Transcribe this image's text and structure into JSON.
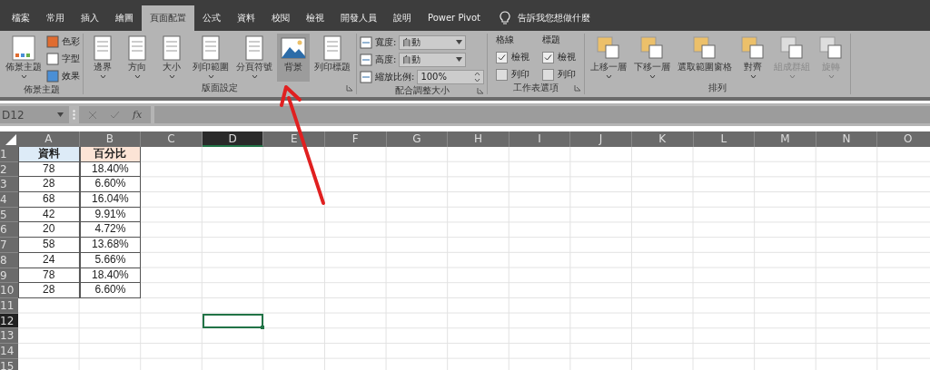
{
  "tabs": [
    {
      "label": "檔案",
      "selected": false
    },
    {
      "label": "常用",
      "selected": false
    },
    {
      "label": "插入",
      "selected": false
    },
    {
      "label": "繪圖",
      "selected": false
    },
    {
      "label": "頁面配置",
      "selected": true
    },
    {
      "label": "公式",
      "selected": false
    },
    {
      "label": "資料",
      "selected": false
    },
    {
      "label": "校閱",
      "selected": false
    },
    {
      "label": "檢視",
      "selected": false
    },
    {
      "label": "開發人員",
      "selected": false
    },
    {
      "label": "說明",
      "selected": false
    },
    {
      "label": "Power Pivot",
      "selected": false
    }
  ],
  "tell_me": "告訴我您想做什麼",
  "groups": [
    {
      "kind": "theme",
      "label": "佈景主題",
      "launcher": false,
      "large": [
        {
          "label": "佈景主題",
          "dropdown": true,
          "disabled": false,
          "highlighted": false
        }
      ],
      "small": [
        "色彩",
        "字型",
        "效果"
      ]
    },
    {
      "kind": "buttons",
      "label": "版面設定",
      "launcher": true,
      "large": [
        {
          "label": "邊界",
          "dropdown": true,
          "disabled": false,
          "highlighted": false
        },
        {
          "label": "方向",
          "dropdown": true,
          "disabled": false,
          "highlighted": false
        },
        {
          "label": "大小",
          "dropdown": true,
          "disabled": false,
          "highlighted": false
        },
        {
          "label": "列印範圍",
          "dropdown": true,
          "disabled": false,
          "highlighted": false
        },
        {
          "label": "分頁符號",
          "dropdown": true,
          "disabled": false,
          "highlighted": false
        },
        {
          "label": "背景",
          "dropdown": false,
          "disabled": false,
          "highlighted": true
        },
        {
          "label": "列印標題",
          "dropdown": false,
          "disabled": false,
          "highlighted": false
        }
      ]
    },
    {
      "kind": "scale",
      "label": "配合調整大小",
      "launcher": true,
      "fields": [
        {
          "label": "寬度:",
          "value": "自動",
          "kind": "dropdown"
        },
        {
          "label": "高度:",
          "value": "自動",
          "kind": "dropdown"
        },
        {
          "label": "縮放比例:",
          "value": "100%",
          "kind": "spinner"
        }
      ]
    },
    {
      "kind": "options",
      "label": "工作表選項",
      "launcher": true,
      "columns": [
        {
          "heading": "格線",
          "options": [
            {
              "label": "檢視",
              "checked": true
            },
            {
              "label": "列印",
              "checked": false
            }
          ]
        },
        {
          "heading": "標題",
          "options": [
            {
              "label": "檢視",
              "checked": true
            },
            {
              "label": "列印",
              "checked": false
            }
          ]
        }
      ]
    },
    {
      "kind": "buttons",
      "label": "排列",
      "launcher": false,
      "large": [
        {
          "label": "上移一層",
          "dropdown": true,
          "disabled": false,
          "highlighted": false
        },
        {
          "label": "下移一層",
          "dropdown": true,
          "disabled": false,
          "highlighted": false
        },
        {
          "label": "選取範圍窗格",
          "dropdown": false,
          "disabled": false,
          "highlighted": false
        },
        {
          "label": "對齊",
          "dropdown": true,
          "disabled": false,
          "highlighted": false
        },
        {
          "label": "組成群組",
          "dropdown": true,
          "disabled": true,
          "highlighted": false
        },
        {
          "label": "旋轉",
          "dropdown": true,
          "disabled": true,
          "highlighted": false
        }
      ]
    }
  ],
  "formula_bar": {
    "name_box": "D12",
    "fx": "fx"
  },
  "columns": [
    {
      "label": "A",
      "selected": false
    },
    {
      "label": "B",
      "selected": false
    },
    {
      "label": "C",
      "selected": false
    },
    {
      "label": "D",
      "selected": true
    },
    {
      "label": "E",
      "selected": false
    },
    {
      "label": "F",
      "selected": false
    },
    {
      "label": "G",
      "selected": false
    },
    {
      "label": "H",
      "selected": false
    },
    {
      "label": "I",
      "selected": false
    },
    {
      "label": "J",
      "selected": false
    },
    {
      "label": "K",
      "selected": false
    },
    {
      "label": "L",
      "selected": false
    },
    {
      "label": "M",
      "selected": false
    },
    {
      "label": "N",
      "selected": false
    },
    {
      "label": "O",
      "selected": false
    }
  ],
  "rows": [
    {
      "label": "1",
      "selected": false
    },
    {
      "label": "2",
      "selected": false
    },
    {
      "label": "3",
      "selected": false
    },
    {
      "label": "4",
      "selected": false
    },
    {
      "label": "5",
      "selected": false
    },
    {
      "label": "6",
      "selected": false
    },
    {
      "label": "7",
      "selected": false
    },
    {
      "label": "8",
      "selected": false
    },
    {
      "label": "9",
      "selected": false
    },
    {
      "label": "10",
      "selected": false
    },
    {
      "label": "11",
      "selected": false
    },
    {
      "label": "12",
      "selected": true
    },
    {
      "label": "13",
      "selected": false
    },
    {
      "label": "14",
      "selected": false
    },
    {
      "label": "15",
      "selected": false
    }
  ],
  "table": {
    "header": [
      {
        "text": "資料",
        "color": "#ddebf7"
      },
      {
        "text": "百分比",
        "color": "#fce4d6"
      }
    ],
    "rows": [
      [
        "78",
        "18.40%"
      ],
      [
        "28",
        "6.60%"
      ],
      [
        "68",
        "16.04%"
      ],
      [
        "42",
        "9.91%"
      ],
      [
        "20",
        "4.72%"
      ],
      [
        "58",
        "13.68%"
      ],
      [
        "24",
        "5.66%"
      ],
      [
        "78",
        "18.40%"
      ],
      [
        "28",
        "6.60%"
      ]
    ]
  }
}
